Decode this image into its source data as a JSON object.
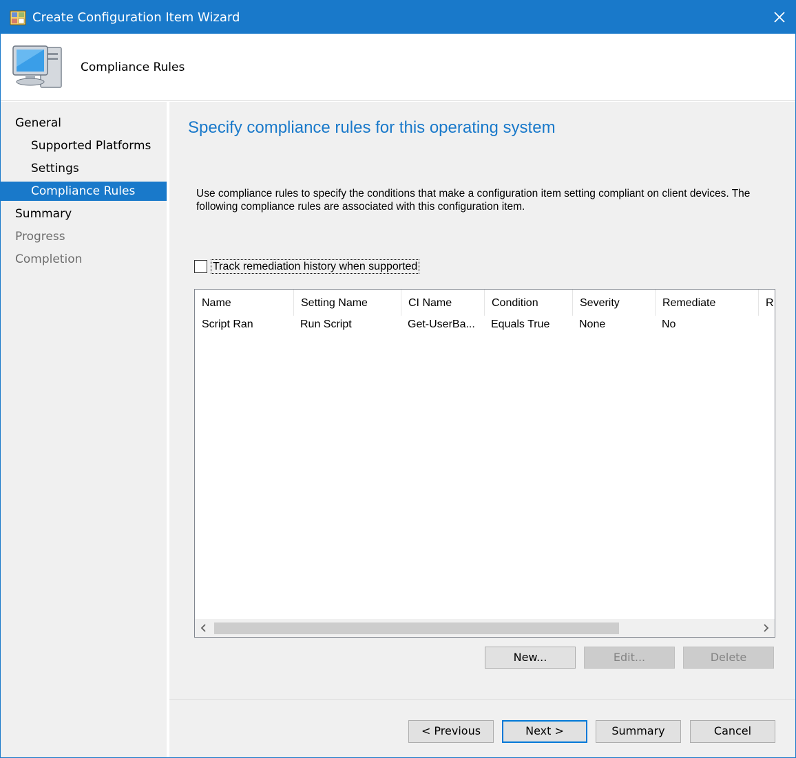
{
  "window": {
    "title": "Create Configuration Item Wizard"
  },
  "header": {
    "title": "Compliance Rules"
  },
  "sidebar": {
    "items": [
      {
        "label": "General"
      },
      {
        "label": "Supported Platforms"
      },
      {
        "label": "Settings"
      },
      {
        "label": "Compliance Rules"
      },
      {
        "label": "Summary"
      },
      {
        "label": "Progress"
      },
      {
        "label": "Completion"
      }
    ]
  },
  "main": {
    "heading": "Specify compliance rules for this operating system",
    "description": "Use compliance rules to specify the conditions that make a configuration item setting compliant on client devices. The following compliance rules are associated with this configuration item.",
    "track_checkbox": {
      "label": "Track remediation history when supported",
      "checked": false
    },
    "table": {
      "columns": [
        "Name",
        "Setting Name",
        "CI Name",
        "Condition",
        "Severity",
        "Remediate",
        "R"
      ],
      "rows": [
        [
          "Script Ran",
          "Run Script",
          "Get-UserBa...",
          "Equals True",
          "None",
          "No",
          ""
        ]
      ]
    },
    "buttons": {
      "new": "New...",
      "edit": "Edit...",
      "delete": "Delete"
    }
  },
  "footer": {
    "previous": "< Previous",
    "next": "Next >",
    "summary": "Summary",
    "cancel": "Cancel"
  },
  "colors": {
    "accent": "#1979ca",
    "panel": "#f0f0f0"
  }
}
